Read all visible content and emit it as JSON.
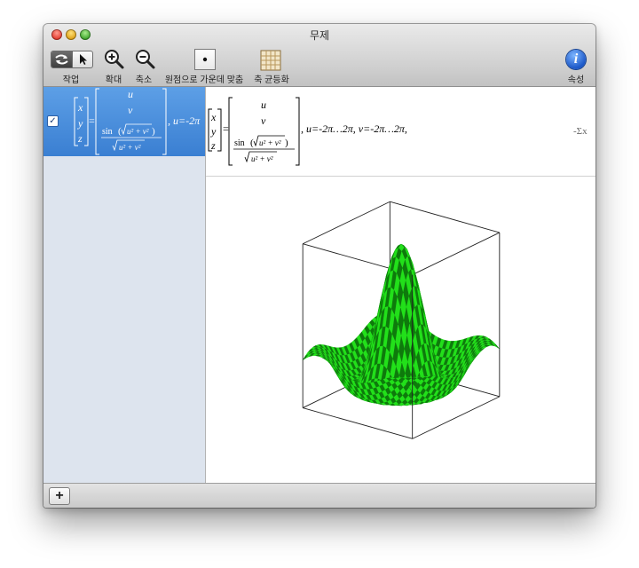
{
  "window": {
    "title": "무제"
  },
  "toolbar": {
    "mode_label": "작업",
    "zoom_in_label": "확대",
    "zoom_out_label": "축소",
    "center_label": "원점으로 가운데 맞춤",
    "equalize_label": "축 균등화",
    "info_label": "속성",
    "info_glyph": "i"
  },
  "sidebar": {
    "equation": {
      "checked": true,
      "check_glyph": "✓",
      "vector": [
        "x",
        "y",
        "z"
      ],
      "components": [
        "u",
        "v"
      ],
      "sin_word": "sin",
      "radicand": "u² + v²",
      "range_prefix": ", u=-2π"
    }
  },
  "equation": {
    "vector": [
      "x",
      "y",
      "z"
    ],
    "equals": "=",
    "components": [
      "u",
      "v"
    ],
    "sin_word": "sin",
    "radicand": "u² + v²",
    "ranges": ", u=-2π…2π, v=-2π…2π,",
    "sigma_glyph": "-Σx"
  },
  "plot": {
    "function": "z = sin(sqrt(u²+v²)) / sqrt(u²+v²)",
    "u_range": [
      "-2π",
      "2π"
    ],
    "v_range": [
      "-2π",
      "2π"
    ],
    "surface_colors": {
      "light": "#22e01a",
      "dark": "#0e7a0c"
    },
    "bounding_box": true
  },
  "footer": {
    "add_glyph": "+"
  }
}
